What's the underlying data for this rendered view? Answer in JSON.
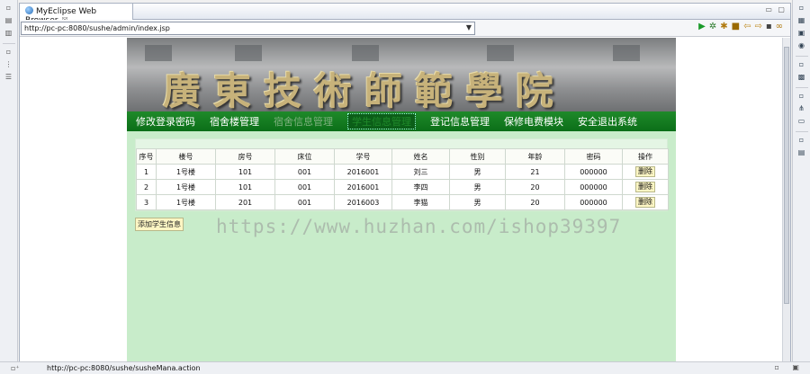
{
  "browser": {
    "tab_title": "MyEclipse Web Browser",
    "tab_close": "☒",
    "url": "http://pc-pc:8080/sushe/admin/index.jsp",
    "status_url": "http://pc-pc:8080/sushe/susheMana.action"
  },
  "banner": {
    "title": "廣東技術師範學院"
  },
  "menu": {
    "items": [
      {
        "label": "修改登录密码"
      },
      {
        "label": "宿舍楼管理"
      },
      {
        "label": "宿舍信息管理"
      },
      {
        "label": "学生信息管理"
      },
      {
        "label": "登记信息管理"
      },
      {
        "label": "保修电费模块"
      },
      {
        "label": "安全退出系统"
      }
    ]
  },
  "table": {
    "headers": [
      "序号",
      "楼号",
      "房号",
      "床位",
      "学号",
      "姓名",
      "性别",
      "年龄",
      "密码",
      "操作"
    ],
    "rows": [
      [
        "1",
        "1号楼",
        "101",
        "001",
        "2016001",
        "刘三",
        "男",
        "21",
        "000000",
        "删除"
      ],
      [
        "2",
        "1号楼",
        "101",
        "001",
        "2016001",
        "李四",
        "男",
        "20",
        "000000",
        "删除"
      ],
      [
        "3",
        "1号楼",
        "201",
        "001",
        "2016003",
        "李猫",
        "男",
        "20",
        "000000",
        "删除"
      ]
    ]
  },
  "actions": {
    "add_student": "添加学生信息"
  },
  "watermark": "https://www.huzhan.com/ishop39397"
}
